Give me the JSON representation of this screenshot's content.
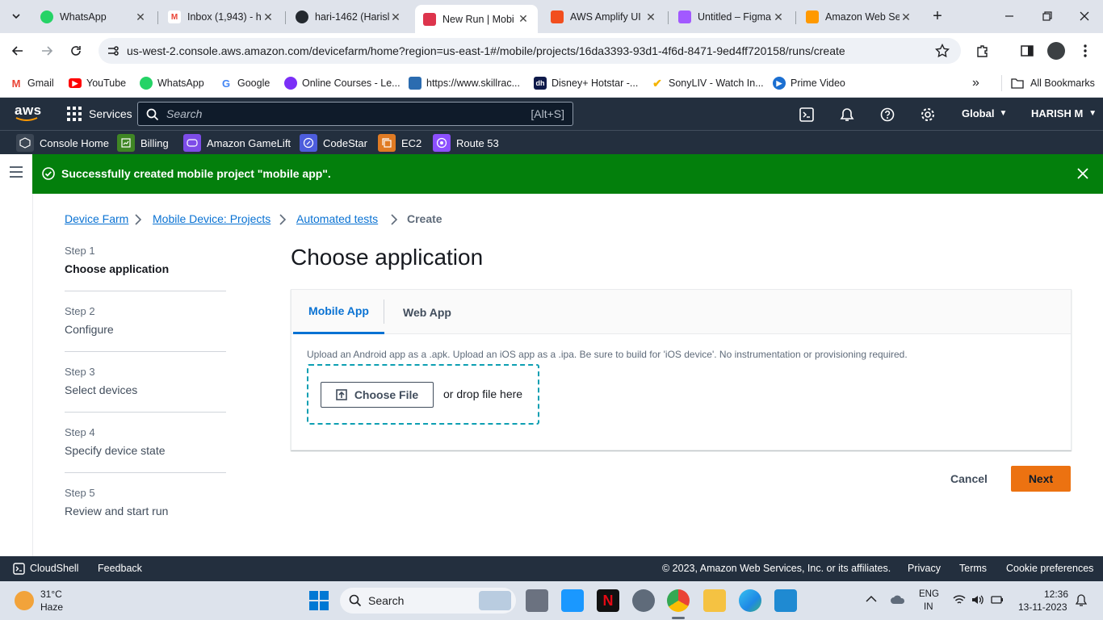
{
  "browser": {
    "tabs": [
      {
        "title": "WhatsApp",
        "icon": "whatsapp-icon"
      },
      {
        "title": "Inbox (1,943) - h",
        "icon": "gmail-icon"
      },
      {
        "title": "hari-1462 (Harisl",
        "icon": "github-icon"
      },
      {
        "title": "New Run | Mobi",
        "icon": "devicefarm-icon"
      },
      {
        "title": "AWS Amplify UI",
        "icon": "figma-icon"
      },
      {
        "title": "Untitled – Figma",
        "icon": "figma-icon"
      },
      {
        "title": "Amazon Web Se",
        "icon": "aws-icon"
      }
    ],
    "url": "us-west-2.console.aws.amazon.com/devicefarm/home?region=us-east-1#/mobile/projects/16da3393-93d1-4f6d-8471-9ed4ff720158/runs/create",
    "bookmarks": [
      "Gmail",
      "YouTube",
      "WhatsApp",
      "Google",
      "Online Courses - Le...",
      "https://www.skillrac...",
      "Disney+ Hotstar -...",
      "SonyLIV - Watch In...",
      "Prime Video"
    ],
    "all_bookmarks": "All Bookmarks"
  },
  "aws": {
    "logo": "aws",
    "services": "Services",
    "search_placeholder": "Search",
    "search_shortcut": "[Alt+S]",
    "region": "Global",
    "user": "HARISH M",
    "favorites": [
      "Console Home",
      "Billing",
      "Amazon GameLift",
      "CodeStar",
      "EC2",
      "Route 53"
    ]
  },
  "flash": {
    "message": "Successfully created mobile project \"mobile app\"."
  },
  "breadcrumbs": [
    "Device Farm",
    "Mobile Device: Projects",
    "Automated tests",
    "Create"
  ],
  "steps": [
    {
      "num": "Step 1",
      "title": "Choose application"
    },
    {
      "num": "Step 2",
      "title": "Configure"
    },
    {
      "num": "Step 3",
      "title": "Select devices"
    },
    {
      "num": "Step 4",
      "title": "Specify device state"
    },
    {
      "num": "Step 5",
      "title": "Review and start run"
    }
  ],
  "main": {
    "heading": "Choose application",
    "tabs": [
      "Mobile App",
      "Web App"
    ],
    "hint": "Upload an Android app as a .apk. Upload an iOS app as a .ipa. Be sure to build for 'iOS device'. No instrumentation or provisioning required.",
    "choose_file": "Choose File",
    "drop_text": "or drop file here",
    "cancel": "Cancel",
    "next": "Next"
  },
  "footer": {
    "cloudshell": "CloudShell",
    "feedback": "Feedback",
    "copyright": "© 2023, Amazon Web Services, Inc. or its affiliates.",
    "privacy": "Privacy",
    "terms": "Terms",
    "cookies": "Cookie preferences"
  },
  "taskbar": {
    "temp": "31°C",
    "weather": "Haze",
    "search": "Search",
    "lang1": "ENG",
    "lang2": "IN",
    "time": "12:36",
    "date": "13-11-2023"
  },
  "colors": {
    "aws_nav": "#232f3e",
    "flash_success": "#037f0c",
    "link": "#0972d3",
    "primary_button": "#ec7211",
    "dropzone": "#0d9fb2"
  }
}
